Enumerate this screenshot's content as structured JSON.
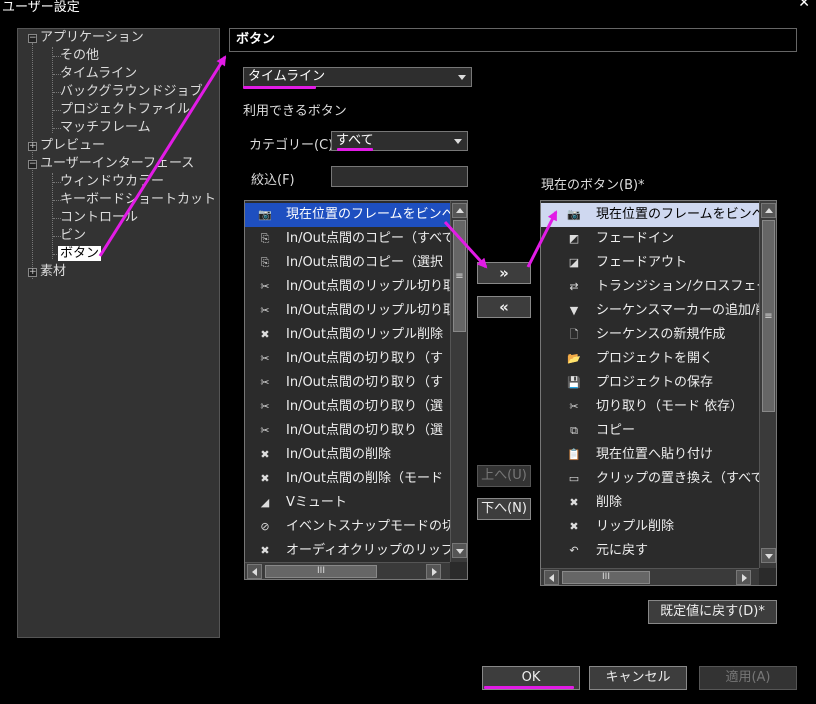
{
  "window": {
    "title": "ユーザー設定",
    "close": "✕"
  },
  "tree": {
    "items": [
      {
        "label": "アプリケーション",
        "expander": "−"
      },
      {
        "label": "その他"
      },
      {
        "label": "タイムライン"
      },
      {
        "label": "バックグラウンドジョブ"
      },
      {
        "label": "プロジェクトファイル"
      },
      {
        "label": "マッチフレーム"
      },
      {
        "label": "プレビュー",
        "expander": "+"
      },
      {
        "label": "ユーザーインターフェース",
        "expander": "−"
      },
      {
        "label": "ウィンドウカラー"
      },
      {
        "label": "キーボードショートカット"
      },
      {
        "label": "コントロール"
      },
      {
        "label": "ビン"
      },
      {
        "label": "ボタン"
      },
      {
        "label": "素材",
        "expander": "+"
      }
    ]
  },
  "panel": {
    "header": "ボタン",
    "target_dropdown": "タイムライン",
    "available_label": "利用できるボタン",
    "category_label": "カテゴリー(C)",
    "category_value": "すべて",
    "filter_label": "絞込(F)",
    "current_label": "現在のボタン(B)*"
  },
  "available_list": [
    {
      "icon": "📷",
      "label": "現在位置のフレームをビンへ"
    },
    {
      "icon": "⎘",
      "label": "In/Out点間のコピー（すべて"
    },
    {
      "icon": "⎘",
      "label": "In/Out点間のコピー（選択"
    },
    {
      "icon": "✂",
      "label": "In/Out点間のリップル切り取"
    },
    {
      "icon": "✂",
      "label": "In/Out点間のリップル切り取"
    },
    {
      "icon": "✖",
      "label": "In/Out点間のリップル削除"
    },
    {
      "icon": "✂",
      "label": "In/Out点間の切り取り（す"
    },
    {
      "icon": "✂",
      "label": "In/Out点間の切り取り（す"
    },
    {
      "icon": "✂",
      "label": "In/Out点間の切り取り（選"
    },
    {
      "icon": "✂",
      "label": "In/Out点間の切り取り（選"
    },
    {
      "icon": "✖",
      "label": "In/Out点間の削除"
    },
    {
      "icon": "✖",
      "label": "In/Out点間の削除（モード"
    },
    {
      "icon": "◢",
      "label": "Vミュート"
    },
    {
      "icon": "⊘",
      "label": "イベントスナップモードの切り"
    },
    {
      "icon": "✖",
      "label": "オーディオクリップのリップル削"
    }
  ],
  "current_list": [
    {
      "icon": "📷",
      "label": "現在位置のフレームをビンへ"
    },
    {
      "icon": "◩",
      "label": "フェードイン"
    },
    {
      "icon": "◪",
      "label": "フェードアウト"
    },
    {
      "icon": "⇄",
      "label": "トランジション/クロスフェード("
    },
    {
      "icon": "▼",
      "label": "シーケンスマーカーの追加/削"
    },
    {
      "icon": "🗋",
      "label": "シーケンスの新規作成"
    },
    {
      "icon": "📂",
      "label": "プロジェクトを開く"
    },
    {
      "icon": "💾",
      "label": "プロジェクトの保存"
    },
    {
      "icon": "✂",
      "label": "切り取り（モード 依存）"
    },
    {
      "icon": "⧉",
      "label": "コピー"
    },
    {
      "icon": "📋",
      "label": "現在位置へ貼り付け"
    },
    {
      "icon": "▭",
      "label": "クリップの置き換え（すべて）"
    },
    {
      "icon": "✖",
      "label": "削除"
    },
    {
      "icon": "✖",
      "label": "リップル削除"
    },
    {
      "icon": "↶",
      "label": "元に戻す"
    }
  ],
  "buttons": {
    "add": "»",
    "remove": "«",
    "up": "上へ(U)",
    "down": "下へ(N)",
    "reset": "既定値に戻す(D)*",
    "ok": "OK",
    "cancel": "キャンセル",
    "apply": "適用(A)"
  },
  "scrollbar": {
    "grip": "≡",
    "hgrip": "III"
  },
  "colors": {
    "annotation": "#e21be6",
    "selection": "#1e4fc0"
  }
}
